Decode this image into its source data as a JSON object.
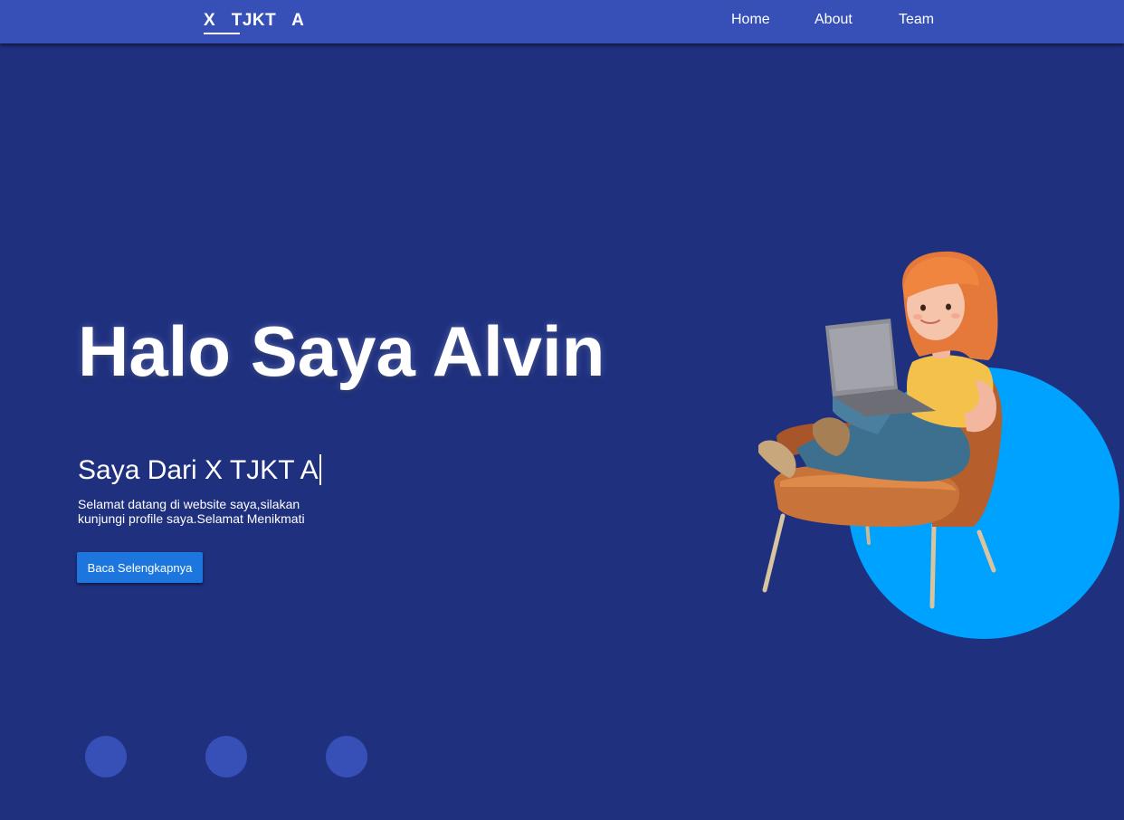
{
  "navbar": {
    "brand": "X  TJKT  A",
    "links": [
      {
        "label": "Home"
      },
      {
        "label": "About"
      },
      {
        "label": "Team"
      }
    ]
  },
  "hero": {
    "title": "Halo Saya Alvin",
    "subtitle": "Saya Dari X TJKT A",
    "description": "Selamat datang di website saya,silakan kunjungi profile saya.Selamat Menikmati",
    "cta_label": "Baca Selengkapnya"
  },
  "illustration": {
    "icon": "girl-with-laptop-on-chair-illustration"
  },
  "colors": {
    "background": "#1f307e",
    "navbar": "#3650b8",
    "accent_circle": "#00a2ff",
    "button": "#1c76de",
    "dots": "#3650b8"
  }
}
